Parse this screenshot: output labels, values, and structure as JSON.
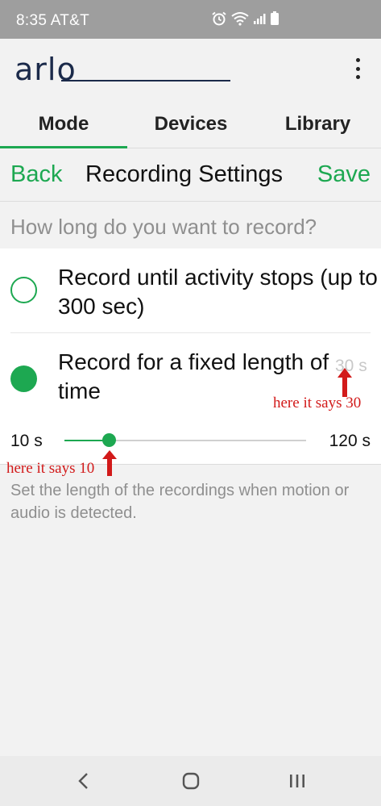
{
  "status_bar": {
    "time_carrier": "8:35 AT&T",
    "icons": [
      "alarm-icon",
      "wifi-icon",
      "signal-icon",
      "battery-icon"
    ]
  },
  "header": {
    "logo": "arlo",
    "menu_icon": "more-vert-icon"
  },
  "tabs": [
    {
      "label": "Mode",
      "active": true
    },
    {
      "label": "Devices",
      "active": false
    },
    {
      "label": "Library",
      "active": false
    }
  ],
  "nav": {
    "back_label": "Back",
    "title": "Recording Settings",
    "save_label": "Save"
  },
  "question": "How long do you want to record?",
  "options": [
    {
      "label": "Record until activity stops (up to 300 sec)",
      "selected": false
    },
    {
      "label": "Record for a fixed length of time",
      "selected": true
    }
  ],
  "fixed_length": {
    "current_value": "30 s",
    "slider_min": "10 s",
    "slider_max": "120 s",
    "slider_value_seconds": 30
  },
  "annotations": {
    "value_note": "here it says 30",
    "slider_note": "here it says 10"
  },
  "description": "Set the length of the recordings when motion or audio is detected.",
  "colors": {
    "accent": "#1da851",
    "annotation": "#d21a1a",
    "muted_text": "#8f8f8f",
    "status_bar": "#9e9e9e"
  },
  "system_nav": [
    "back-icon",
    "home-icon",
    "recents-icon"
  ]
}
